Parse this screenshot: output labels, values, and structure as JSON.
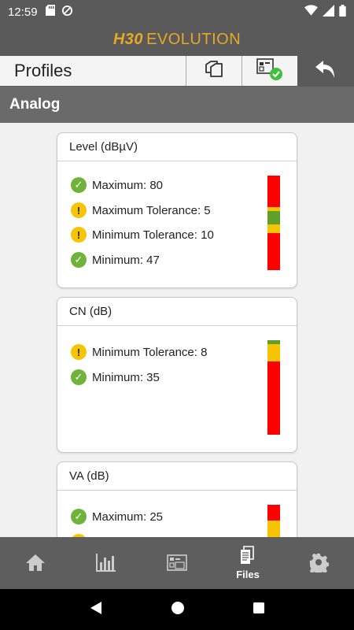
{
  "status": {
    "time": "12:59"
  },
  "brand": {
    "h30": "H30",
    "evolution": "EVOLUTION"
  },
  "toolbar": {
    "title": "Profiles"
  },
  "section": {
    "title": "Analog"
  },
  "cards": [
    {
      "title": "Level (dBµV)",
      "rows": [
        {
          "status": "ok",
          "label": "Maximum: 80"
        },
        {
          "status": "warn",
          "label": "Maximum Tolerance: 5"
        },
        {
          "status": "warn",
          "label": "Minimum Tolerance: 10"
        },
        {
          "status": "ok",
          "label": "Minimum: 47"
        }
      ]
    },
    {
      "title": "CN (dB)",
      "rows": [
        {
          "status": "warn",
          "label": "Minimum Tolerance: 8"
        },
        {
          "status": "ok",
          "label": "Minimum: 35"
        }
      ]
    },
    {
      "title": "VA (dB)",
      "rows": [
        {
          "status": "ok",
          "label": "Maximum: 25"
        }
      ]
    }
  ],
  "nav": {
    "home": "",
    "measure": "",
    "profiles": "",
    "files": "Files",
    "settings": ""
  },
  "colors": {
    "red": "#ff0000",
    "yellow": "#f6c400",
    "green": "#5f9f2a",
    "accent": "#e7a824"
  }
}
